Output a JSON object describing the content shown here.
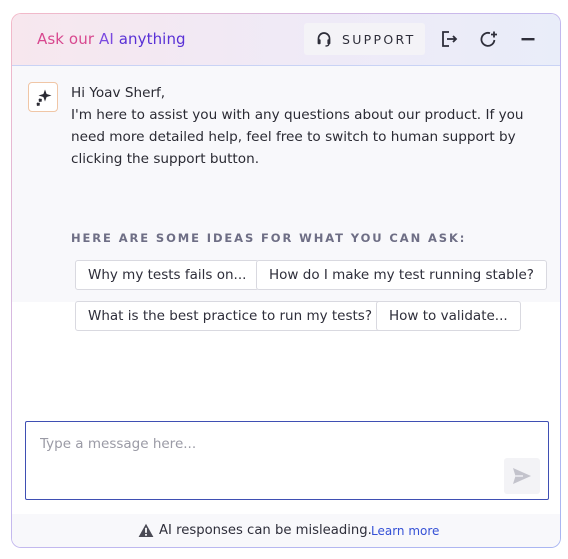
{
  "header": {
    "title_part1": "Ask our ",
    "title_part2": "AI ",
    "title_part3": "anything",
    "support_label": "SUPPORT",
    "icons": [
      "headset-icon",
      "exit-icon",
      "new-chat-icon",
      "minimize-icon"
    ]
  },
  "message": {
    "greeting": "Hi Yoav Sherf,",
    "body": "I'm here to assist you with any questions about our product. If you need more detailed help, feel free to switch to human support by clicking the support button."
  },
  "ideas": {
    "title": "HERE ARE SOME IDEAS FOR WHAT YOU CAN ASK:",
    "chips": [
      "Why my tests fails on...",
      "How do I make my test running stable?",
      "What is the best practice to run my tests?",
      "How to validate..."
    ]
  },
  "input": {
    "placeholder": "Type a message here...",
    "value": ""
  },
  "footer": {
    "disclaimer": "AI responses can be misleading.",
    "learn_more": "Learn more"
  },
  "colors": {
    "title_pink": "#d8488f",
    "title_purple": "#5930d6",
    "input_border": "#3f4fb3",
    "link": "#3551d6"
  }
}
